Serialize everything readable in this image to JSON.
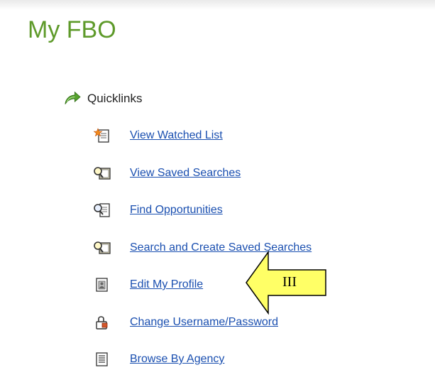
{
  "page": {
    "title": "My FBO"
  },
  "quicklinks": {
    "label": "Quicklinks",
    "icon": "green-arrow-icon",
    "items": [
      {
        "label": "View Watched List",
        "icon": "watched-list-star-icon"
      },
      {
        "label": "View Saved Searches",
        "icon": "saved-searches-icon"
      },
      {
        "label": "Find Opportunities",
        "icon": "magnifier-document-icon"
      },
      {
        "label": "Search and Create Saved Searches",
        "icon": "saved-searches-icon"
      },
      {
        "label": "Edit My Profile",
        "icon": "profile-document-icon"
      },
      {
        "label": "Change Username/Password",
        "icon": "lock-icon"
      },
      {
        "label": "Browse By Agency",
        "icon": "list-document-icon"
      }
    ]
  },
  "annotation": {
    "label": "III",
    "fill_color": "#ffff66",
    "stroke_color": "#000000"
  },
  "colors": {
    "title": "#5e9a2a",
    "link": "#1a4fb0"
  }
}
